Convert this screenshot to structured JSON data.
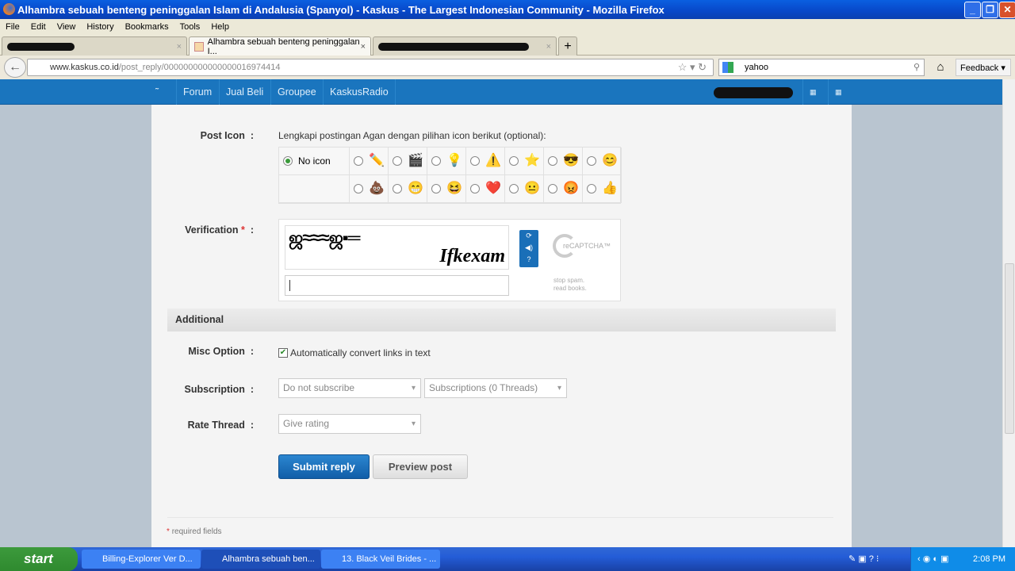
{
  "window": {
    "title": "Alhambra sebuah benteng peninggalan Islam di Andalusia (Spanyol) - Kaskus - The Largest Indonesian Community - Mozilla Firefox"
  },
  "menu": [
    "File",
    "Edit",
    "View",
    "History",
    "Bookmarks",
    "Tools",
    "Help"
  ],
  "tabs": [
    {
      "label": ""
    },
    {
      "label": "Alhambra sebuah benteng peninggalan I..."
    },
    {
      "label": ""
    }
  ],
  "navbar": {
    "url_domain": "www.kaskus.co.id",
    "url_path": "/post_reply/000000000000000016974414",
    "search_value": "yahoo",
    "feedback": "Feedback"
  },
  "kaskus_nav": [
    "Forum",
    "Jual Beli",
    "Groupee",
    "KaskusRadio"
  ],
  "form": {
    "post_icon_label": "Post Icon",
    "post_icon_hint": "Lengkapi postingan Agan dengan pilihan icon berikut (optional):",
    "no_icon": "No icon",
    "icons_row1": [
      "pencil-icon",
      "clapperboard-icon",
      "lightbulb-icon",
      "warning-icon",
      "star-icon",
      "cool-face-icon",
      "smile-face-icon"
    ],
    "icons_row2": [
      "poop-icon",
      "grin-face-icon",
      "laugh-face-icon",
      "heart-icon",
      "blue-face-icon",
      "angry-face-icon",
      "thumbs-up-icon"
    ],
    "verification_label": "Verification",
    "required_mark": "*",
    "captcha_words": "Ifkexam",
    "recaptcha_logo": "reCAPTCHA™",
    "recaptcha_tagline_1": "stop spam.",
    "recaptcha_tagline_2": "read books.",
    "additional": "Additional",
    "misc_label": "Misc Option",
    "misc_checkbox": "Automatically convert links in text",
    "subscription_label": "Subscription",
    "subscription_value": "Do not subscribe",
    "subscriptions_value": "Subscriptions (0 Threads)",
    "rate_label": "Rate Thread",
    "rate_value": "Give rating",
    "submit": "Submit reply",
    "preview": "Preview post",
    "required_note": "required fields"
  },
  "taskbar": {
    "start": "start",
    "tasks": [
      "Billing-Explorer Ver D...",
      "Alhambra sebuah ben...",
      "13. Black Veil Brides - ..."
    ],
    "clock": "2:08 PM"
  },
  "colors": {
    "kaskus_blue": "#1a75be",
    "submit_blue": "#1a6fb8"
  }
}
